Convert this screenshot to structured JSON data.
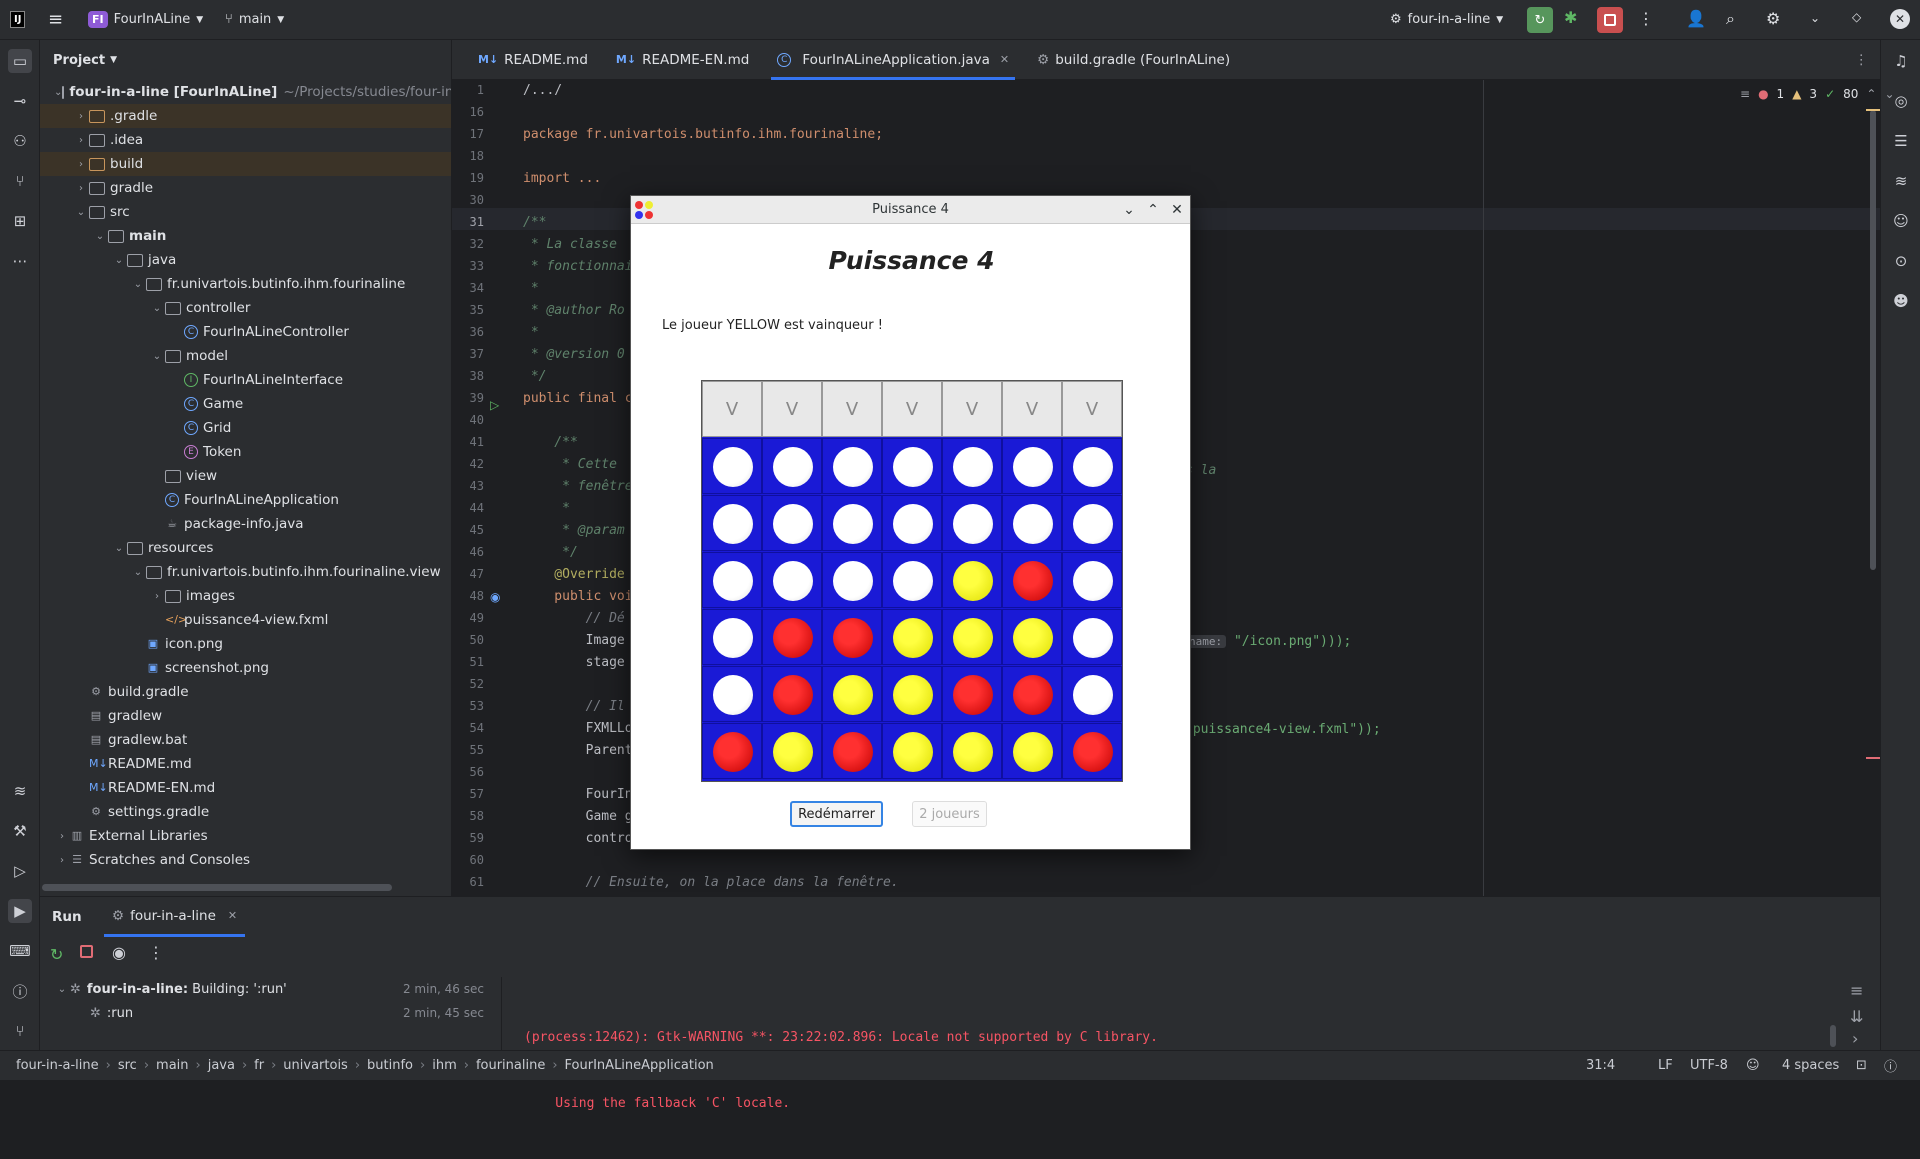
{
  "topbar": {
    "project_badge": "FI",
    "project_name": "FourInALine",
    "branch": "main",
    "run_config": "four-in-a-line"
  },
  "project_panel": {
    "title": "Project",
    "rows": [
      {
        "label": "four-in-a-line [FourInALine]",
        "extra": "~/Projects/studies/four-in-a"
      },
      {
        "label": ".gradle"
      },
      {
        "label": ".idea"
      },
      {
        "label": "build"
      },
      {
        "label": "gradle"
      },
      {
        "label": "src"
      },
      {
        "label": "main"
      },
      {
        "label": "java"
      },
      {
        "label": "fr.univartois.butinfo.ihm.fourinaline"
      },
      {
        "label": "controller"
      },
      {
        "label": "FourInALineController"
      },
      {
        "label": "model"
      },
      {
        "label": "FourInALineInterface"
      },
      {
        "label": "Game"
      },
      {
        "label": "Grid"
      },
      {
        "label": "Token"
      },
      {
        "label": "view"
      },
      {
        "label": "FourInALineApplication"
      },
      {
        "label": "package-info.java"
      },
      {
        "label": "resources"
      },
      {
        "label": "fr.univartois.butinfo.ihm.fourinaline.view"
      },
      {
        "label": "images"
      },
      {
        "label": "puissance4-view.fxml"
      },
      {
        "label": "icon.png"
      },
      {
        "label": "screenshot.png"
      },
      {
        "label": "build.gradle"
      },
      {
        "label": "gradlew"
      },
      {
        "label": "gradlew.bat"
      },
      {
        "label": "README.md"
      },
      {
        "label": "README-EN.md"
      },
      {
        "label": "settings.gradle"
      },
      {
        "label": "External Libraries"
      },
      {
        "label": "Scratches and Consoles"
      }
    ]
  },
  "tabs": [
    "README.md",
    "README-EN.md",
    "FourInALineApplication.java",
    "build.gradle (FourInALine)"
  ],
  "inspections": {
    "errors": "1",
    "warnings": "3",
    "ok": "80"
  },
  "code_lines": [
    {
      "n": "1",
      "t": "/.../"
    },
    {
      "n": "16",
      "t": ""
    },
    {
      "n": "17",
      "t": "package fr.univartois.butinfo.ihm.fourinaline;"
    },
    {
      "n": "18",
      "t": ""
    },
    {
      "n": "19",
      "t": "import ..."
    },
    {
      "n": "30",
      "t": ""
    },
    {
      "n": "31",
      "t": "/**"
    },
    {
      "n": "32",
      "t": " * La classe "
    },
    {
      "n": "33",
      "t": " * fonctionnai"
    },
    {
      "n": "34",
      "t": " *"
    },
    {
      "n": "35",
      "t": " * @author Ro"
    },
    {
      "n": "36",
      "t": " *"
    },
    {
      "n": "37",
      "t": " * @version 0"
    },
    {
      "n": "38",
      "t": " */"
    },
    {
      "n": "39",
      "t": "public final c"
    },
    {
      "n": "40",
      "t": ""
    },
    {
      "n": "41",
      "t": "    /**"
    },
    {
      "n": "42",
      "t": "     * Cette "
    },
    {
      "n": "43",
      "t": "     * fenêtre"
    },
    {
      "n": "44",
      "t": "     *"
    },
    {
      "n": "45",
      "t": "     * @param"
    },
    {
      "n": "46",
      "t": "     */"
    },
    {
      "n": "47",
      "t": "    @Override"
    },
    {
      "n": "48",
      "t": "    public voi"
    },
    {
      "n": "49",
      "t": "        // Dé"
    },
    {
      "n": "50",
      "t": "        Image"
    },
    {
      "n": "51",
      "t": "        stage"
    },
    {
      "n": "52",
      "t": ""
    },
    {
      "n": "53",
      "t": "        // Il"
    },
    {
      "n": "54",
      "t": "        FXMLLo"
    },
    {
      "n": "55",
      "t": "        Parent"
    },
    {
      "n": "56",
      "t": ""
    },
    {
      "n": "57",
      "t": "        FourIn"
    },
    {
      "n": "58",
      "t": "        Game g"
    },
    {
      "n": "59",
      "t": "        contro"
    },
    {
      "n": "60",
      "t": ""
    },
    {
      "n": "61",
      "t": "        // Ensuite, on la place dans la fenêtre."
    }
  ],
  "code_right": {
    "line42": "s la",
    "line50_hint": "name:",
    "line50": "\"/icon.png\")));",
    "line54": "\"puissance4-view.fxml\"));"
  },
  "dialog": {
    "window_title": "Puissance 4",
    "heading": "Puissance 4",
    "status": "Le joueur YELLOW est vainqueur !",
    "column_label": "V",
    "restart": "Redémarrer",
    "players": "2 joueurs",
    "grid": [
      [
        "white",
        "white",
        "white",
        "white",
        "white",
        "white",
        "white"
      ],
      [
        "white",
        "white",
        "white",
        "white",
        "white",
        "white",
        "white"
      ],
      [
        "white",
        "white",
        "white",
        "white",
        "yellow",
        "red",
        "white"
      ],
      [
        "white",
        "red",
        "red",
        "yellow",
        "yellow",
        "yellow",
        "white"
      ],
      [
        "white",
        "red",
        "yellow",
        "yellow",
        "red",
        "red",
        "white"
      ],
      [
        "red",
        "yellow",
        "red",
        "yellow",
        "yellow",
        "yellow",
        "red"
      ]
    ]
  },
  "run_panel": {
    "tab_run": "Run",
    "tab_config": "four-in-a-line",
    "tree": [
      {
        "label": "four-in-a-line:",
        "detail": "Building: ':run'",
        "time": "2 min, 46 sec"
      },
      {
        "label": ":run",
        "time": "2 min, 45 sec"
      }
    ],
    "console": [
      "(process:12462): Gtk-WARNING **: 23:22:02.896: Locale not supported by C library.",
      "    Using the fallback 'C' locale."
    ]
  },
  "statusbar": {
    "crumbs": [
      "four-in-a-line",
      "src",
      "main",
      "java",
      "fr",
      "univartois",
      "butinfo",
      "ihm",
      "fourinaline",
      "FourInALineApplication"
    ],
    "position": "31:4",
    "line_sep": "LF",
    "encoding": "UTF-8",
    "indent": "4 spaces"
  }
}
